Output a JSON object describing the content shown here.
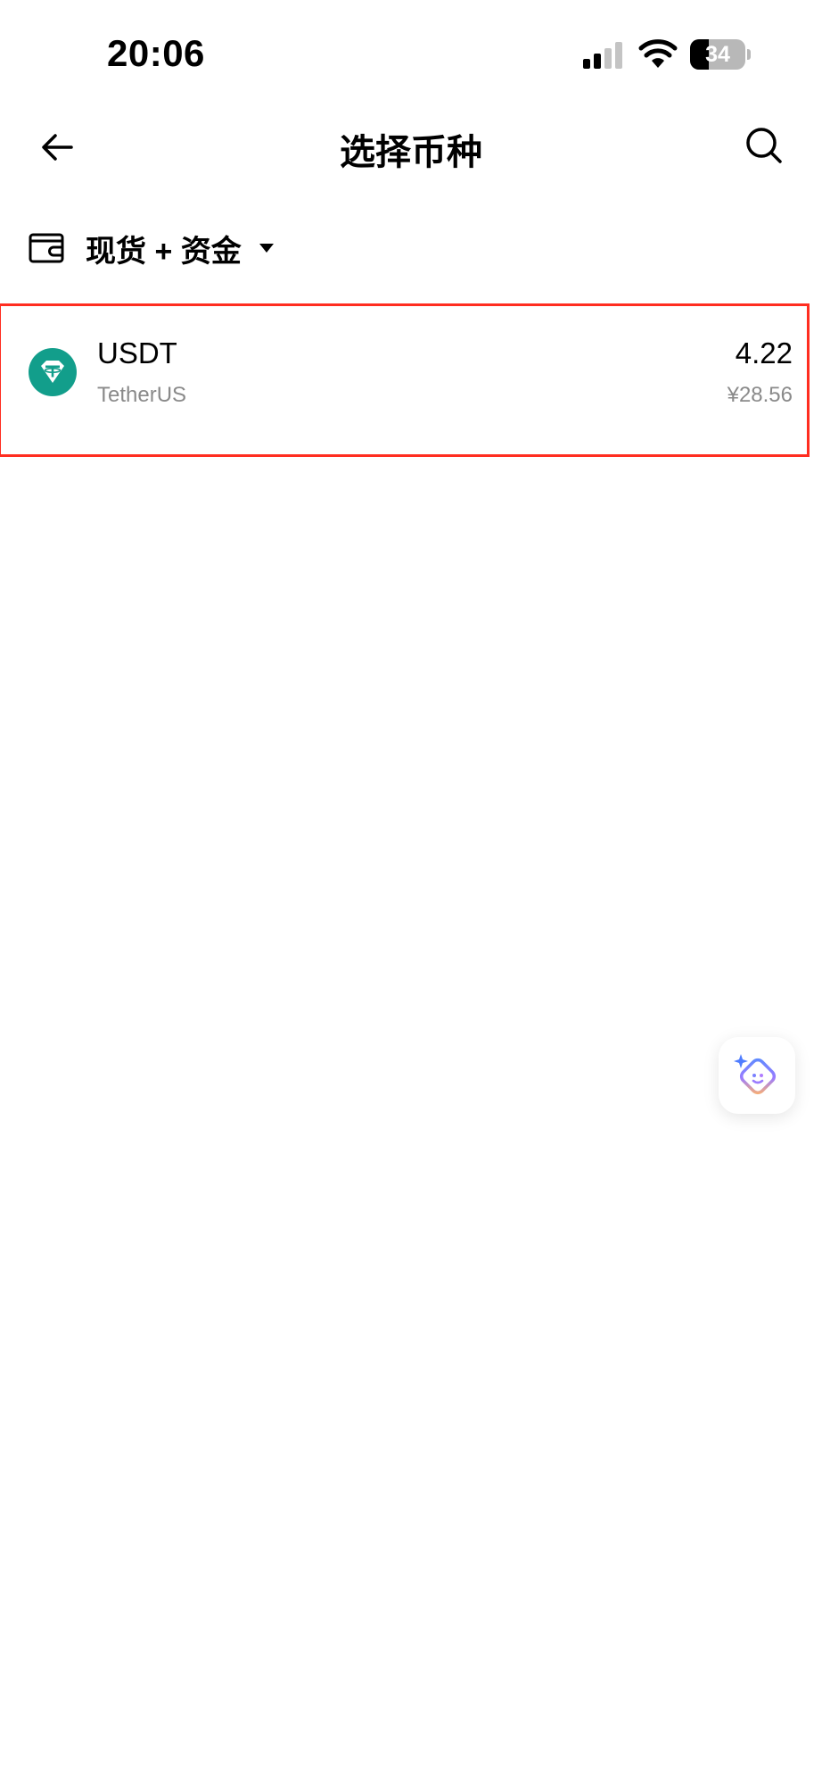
{
  "status_bar": {
    "time": "20:06",
    "battery_level": "34"
  },
  "nav": {
    "title": "选择币种",
    "back_icon": "arrow-left-icon",
    "search_icon": "search-icon"
  },
  "account_filter": {
    "label": "现货 + 资金",
    "icon": "wallet-icon",
    "dropdown_icon": "caret-down-icon"
  },
  "coins": [
    {
      "symbol": "USDT",
      "name": "TetherUS",
      "amount": "4.22",
      "fiat_value": "¥28.56",
      "icon": "tether-logo-icon",
      "icon_color": "#129E8B"
    }
  ],
  "assistant": {
    "icon": "ai-assistant-icon"
  },
  "colors": {
    "highlight_border": "#FF2D20",
    "secondary_text": "#8A8A8A"
  }
}
